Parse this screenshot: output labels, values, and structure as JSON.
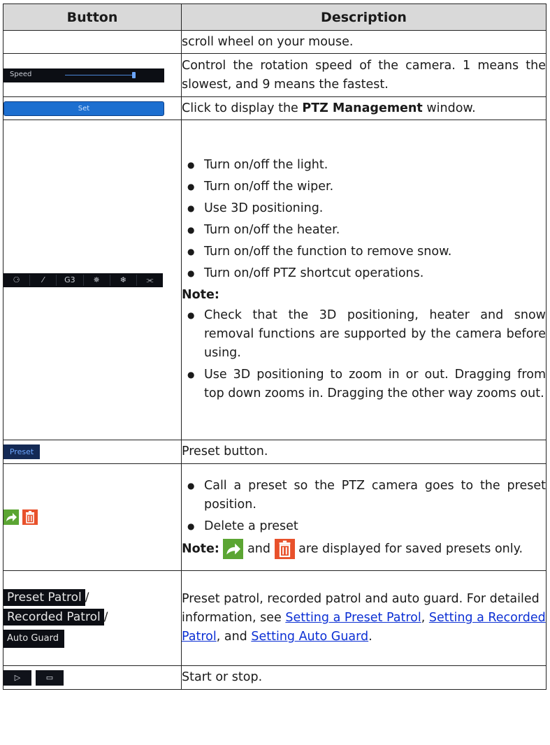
{
  "headers": {
    "button": "Button",
    "description": "Description"
  },
  "row_scroll": {
    "text": "scroll wheel on your mouse."
  },
  "row_speed": {
    "widget_label": "Speed",
    "text": "Control the rotation speed of the camera. 1 means the slowest, and 9 means the fastest."
  },
  "row_set": {
    "widget_label": "Set",
    "text_pre": "Click to display the ",
    "text_bold": "PTZ Management",
    "text_post": " window."
  },
  "row_functions": {
    "icons": [
      "light-icon",
      "wiper-icon",
      "3d-positioning-icon",
      "heater-icon",
      "snow-removal-icon",
      "shortcut-icon"
    ],
    "icon_glyphs": [
      "⚆",
      "⁄",
      "G3",
      "✵",
      "❄",
      "⫘"
    ],
    "bullets": [
      "Turn on/off the light.",
      "Turn on/off the wiper.",
      "Use 3D positioning.",
      "Turn on/off the heater.",
      "Turn on/off the function to remove snow.",
      "Turn on/off PTZ shortcut operations."
    ],
    "note_label": "Note:",
    "notes": [
      "Check that the 3D positioning, heater and snow removal functions are supported by the camera before using.",
      "Use 3D positioning to zoom in or out. Dragging from top down zooms in. Dragging the other way zooms out."
    ]
  },
  "row_preset": {
    "widget_label": "Preset",
    "text": "Preset button."
  },
  "row_call_delete": {
    "bullets": [
      "Call a preset so the PTZ camera goes to the preset position.",
      "Delete a preset"
    ],
    "note_label": "Note:",
    "note_and": "and",
    "note_tail": "are displayed for saved presets only."
  },
  "row_patrol": {
    "tags": [
      "Preset Patrol",
      "Recorded Patrol",
      "Auto Guard"
    ],
    "slash": "/",
    "text1": "Preset patrol, recorded patrol and auto guard. For detailed information, see ",
    "link1": "Setting a Preset Patrol",
    "sep1": ", ",
    "link2": "Setting a Recorded Patrol",
    "sep2": ", and ",
    "link3": "Setting Auto Guard",
    "end": "."
  },
  "row_startstop": {
    "glyphs": [
      "▷",
      "▭"
    ],
    "text": "Start or stop."
  }
}
